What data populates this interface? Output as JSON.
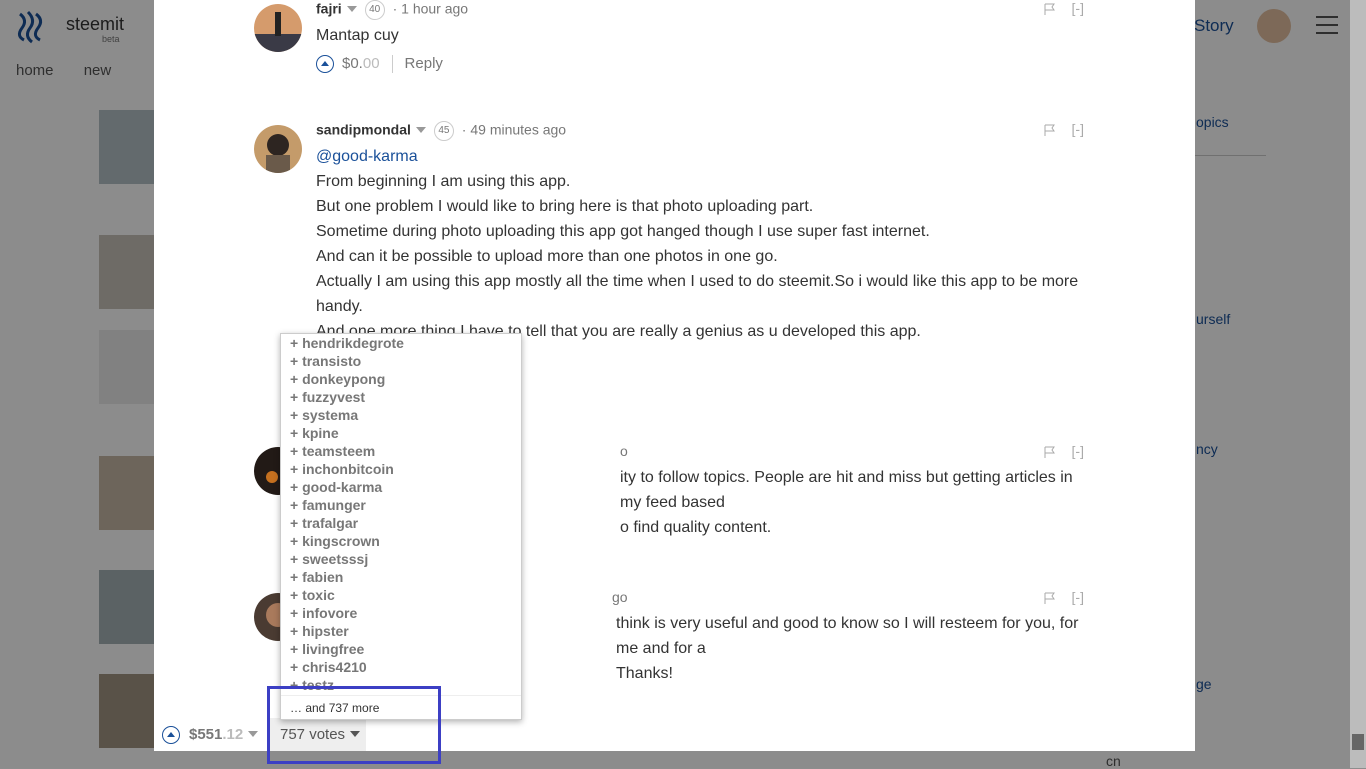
{
  "background": {
    "brand": "steemit",
    "beta": "beta",
    "nav": [
      "home",
      "new"
    ],
    "story": "Story",
    "side_texts": [
      "opics",
      "urself",
      "ncy",
      "ge",
      "cn"
    ]
  },
  "comments": [
    {
      "author": "fajri",
      "rep": "40",
      "time": "1 hour ago",
      "paragraphs": [
        "Mantap cuy"
      ],
      "payout_main": "$0.",
      "payout_cents": "00",
      "reply": "Reply",
      "collapse": "[-]"
    },
    {
      "author": "sandipmondal",
      "rep": "45",
      "time": "49 minutes ago",
      "mention": "@good-karma",
      "paragraphs": [
        "From beginning I am using this app.",
        "But one problem I would like to bring here is that photo uploading part.",
        "Sometime during photo uploading this app got hanged though I use super fast internet.",
        "And can it be possible to upload more than one photos in one go.",
        "Actually I am using this app mostly all the time when I used to do steemit.So i would like this app to be more handy.",
        "And one more thing I have to tell that you are really a genius as u developed this app."
      ],
      "collapse": "[-]"
    },
    {
      "time_partial": "o",
      "text_partial_1": "ity to follow topics. People are hit and miss but getting articles in my feed based",
      "text_partial_2": "o find quality content.",
      "collapse": "[-]"
    },
    {
      "time_partial": "go",
      "text_partial_1": "think is very useful and good to know so I will resteem for you, for me and for a",
      "text_partial_2": "Thanks!",
      "collapse": "[-]"
    }
  ],
  "voters": {
    "list": [
      "+ hendrikdegrote",
      "+ transisto",
      "+ donkeypong",
      "+ fuzzyvest",
      "+ systema",
      "+ kpine",
      "+ teamsteem",
      "+ inchonbitcoin",
      "+ good-karma",
      "+ famunger",
      "+ trafalgar",
      "+ kingscrown",
      "+ sweetsssj",
      "+ fabien",
      "+ toxic",
      "+ infovore",
      "+ hipster",
      "+ livingfree",
      "+ chris4210",
      "+ testz"
    ],
    "more": "… and 737 more"
  },
  "bottom_bar": {
    "payout_main": "$551",
    "payout_cents": ".12",
    "votes_label": "757 votes"
  },
  "colors": {
    "link": "#1a5099",
    "highlight": "#3c3fc4"
  }
}
